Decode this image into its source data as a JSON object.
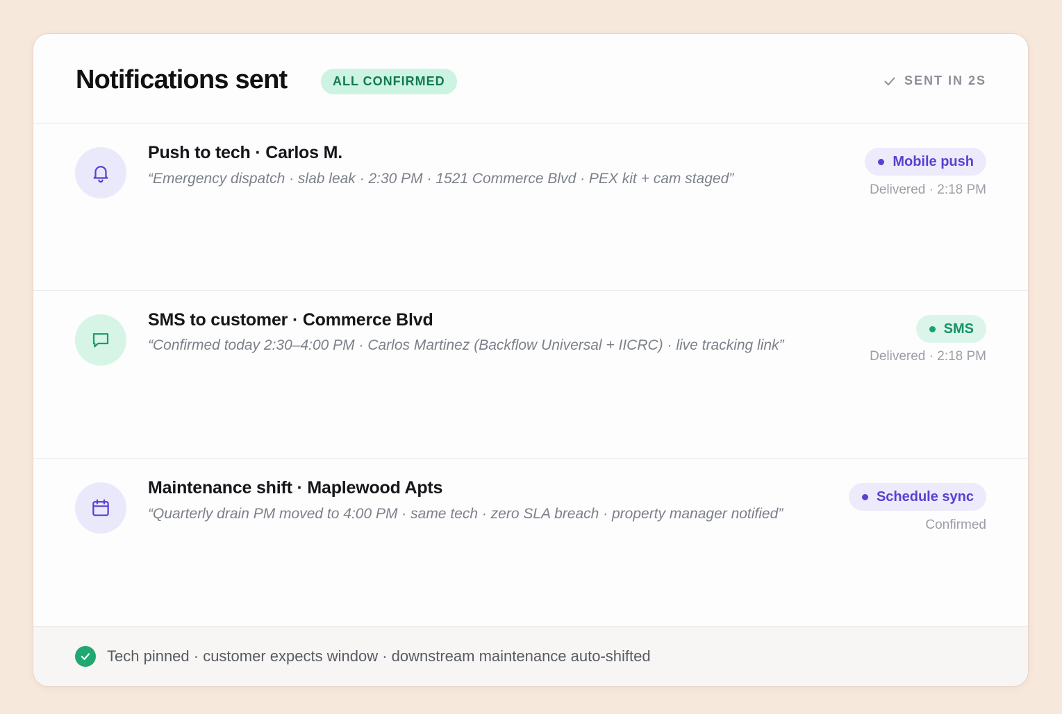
{
  "header": {
    "title": "Notifications sent",
    "badge": "ALL CONFIRMED",
    "meta": "SENT IN 2S",
    "meta_icon": "check-icon"
  },
  "notifications": [
    {
      "icon": "bell-icon",
      "title": "Push to tech · Carlos M.",
      "quote": "“Emergency dispatch · slab leak · 2:30 PM · 1521 Commerce Blvd · PEX kit + cam staged”",
      "channel": "Mobile push",
      "status": "Delivered · 2:18 PM"
    },
    {
      "icon": "message-icon",
      "title": "SMS to customer · Commerce Blvd",
      "quote": "“Confirmed today 2:30–4:00 PM · Carlos Martinez (Backflow Universal + IICRC) · live tracking link”",
      "channel": "SMS",
      "status": "Delivered · 2:18 PM"
    },
    {
      "icon": "calendar-icon",
      "title": "Maintenance shift · Maplewood Apts",
      "quote": "“Quarterly drain PM moved to 4:00 PM · same tech · zero SLA breach · property manager notified”",
      "channel": "Schedule sync",
      "status": "Confirmed"
    }
  ],
  "footer": {
    "icon": "check-circle-icon",
    "text": "Tech pinned · customer expects window · downstream maintenance auto-shifted"
  },
  "colors": {
    "background": "#f7e8dc",
    "card": "#fdfdfd",
    "accent_violet": "#5b3fd1",
    "accent_green": "#179365",
    "confirmed_badge_bg": "#cdf3e2",
    "confirmed_badge_text": "#117a52"
  }
}
